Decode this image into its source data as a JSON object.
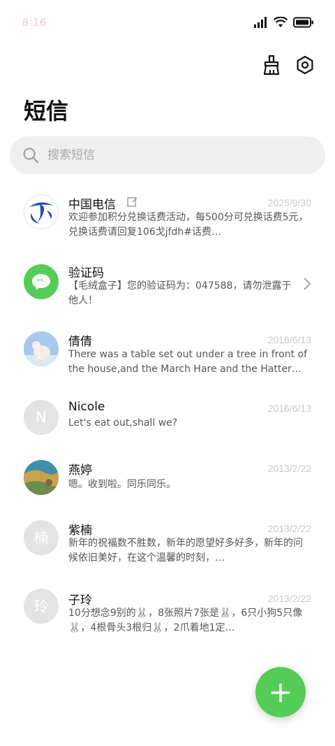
{
  "status_bar": {
    "time": "8:16"
  },
  "header": {
    "title": "短信"
  },
  "search": {
    "placeholder": "搜索短信"
  },
  "messages": [
    {
      "name": "中国电信",
      "date": "2025/9/30",
      "preview": "欢迎参加积分兑换话费活动，每500分可兑换话费5元，兑换话费请回复106戈jfdh#话费…"
    },
    {
      "name": "验证码",
      "preview": "【毛绒盒子】您的验证码为：047588，请勿泄露于他人！"
    },
    {
      "name": "倩倩",
      "date": "2016/6/13",
      "preview": "There was a table set out under a tree in front of the house,and the March Hare and the Hatter we…"
    },
    {
      "name": "Nicole",
      "avatar_letter": "N",
      "date": "2016/6/13",
      "preview": "Let's eat out,shall we?"
    },
    {
      "name": "燕婷",
      "date": "2013/2/22",
      "preview": "嗯。收到啦。同乐同乐。"
    },
    {
      "name": "紫楠",
      "avatar_letter": "楠",
      "date": "2013/2/22",
      "preview": "新年的祝福数不胜数，新年的愿望好多好多，新年的问候依旧美好，在这个温馨的时刻，…"
    },
    {
      "name": "子玲",
      "avatar_letter": "玲",
      "date": "2013/2/22",
      "preview": "10分想念9别的🐰，8张照片7张是🐰，6只小狗5只像🐰，4根骨头3根归🐰，2爪着地1定…"
    }
  ],
  "fab": {
    "label": "+"
  },
  "colors": {
    "accent": "#55cc55",
    "telecom_blue": "#1e4fa3",
    "verify_green": "#55cc55"
  }
}
